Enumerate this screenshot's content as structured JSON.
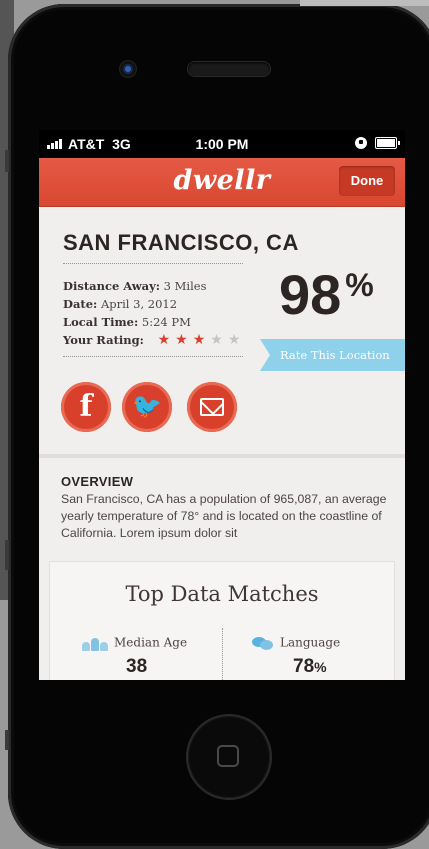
{
  "status_bar": {
    "carrier": "AT&T",
    "network": "3G",
    "time": "1:00 PM"
  },
  "nav": {
    "app_name": "dwellr",
    "done_label": "Done"
  },
  "location": {
    "city": "SAN FRANCISCO, CA",
    "match_percent": "98",
    "percent_sign": "%",
    "rate_label": "Rate This Location",
    "details": [
      {
        "label": "Distance Away:",
        "value": "3 Miles"
      },
      {
        "label": "Date:",
        "value": "April 3, 2012"
      },
      {
        "label": "Local Time:",
        "value": "5:24 PM"
      }
    ],
    "rating_label": "Your Rating:",
    "rating": {
      "filled": 3,
      "total": 5
    }
  },
  "social": {
    "icons": [
      "facebook-icon",
      "twitter-icon",
      "mail-icon"
    ],
    "facebook_glyph": "f",
    "twitter_glyph": "🐦"
  },
  "overview": {
    "title": "OVERVIEW",
    "text": "San Francisco, CA has a population of 965,087, an average yearly temperature of 78° and is located on the coastline of California. Lorem ipsum dolor sit"
  },
  "top_matches": {
    "title": "Top Data Matches",
    "metrics": [
      {
        "label": "Median Age",
        "value": "38",
        "icon": "people-icon"
      },
      {
        "label": "Language",
        "value": "78",
        "suffix": "%",
        "icon": "speech-bubble-icon"
      }
    ]
  },
  "colors": {
    "brand_red": "#d94730",
    "accent_blue": "#8fd0ea",
    "star_active": "#d9402c"
  }
}
